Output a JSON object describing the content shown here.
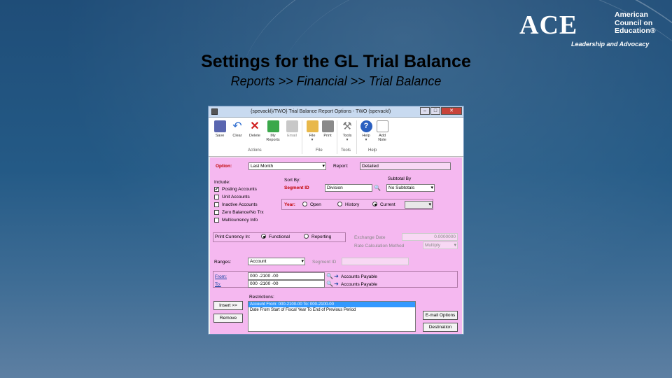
{
  "logo": {
    "wordmark": "ACE",
    "org_line1": "American",
    "org_line2": "Council on",
    "org_line3": "Education®",
    "tagline": "Leadership and Advocacy"
  },
  "slide": {
    "title": "Settings for the GL Trial Balance",
    "subtitle": "Reports >> Financial >> Trial Balance"
  },
  "window": {
    "title": "{spevackl}/TWO} Trial Balance Report Options  -  TWO (spevackl)"
  },
  "toolbar": {
    "save": "Save",
    "clear": "Clear",
    "delete": "Delete",
    "my_reports_1": "My",
    "my_reports_2": "Reports",
    "email": "Email",
    "file": "File",
    "print": "Print",
    "tools": "Tools",
    "help": "Help",
    "add_note_1": "Add",
    "add_note_2": "Note",
    "group_actions": "Actions",
    "group_file": "File",
    "group_tools": "Tools",
    "group_help": "Help"
  },
  "form": {
    "option_label": "Option:",
    "option_value": "Last Month",
    "report_label": "Report:",
    "report_value": "Detailed",
    "include_label": "Include:",
    "include_items": [
      {
        "label": "Posting Accounts",
        "checked": true
      },
      {
        "label": "Unit Accounts",
        "checked": false
      },
      {
        "label": "Inactive Accounts",
        "checked": false
      },
      {
        "label": "Zero Balance/No Trx",
        "checked": false
      },
      {
        "label": "Multicurrency Info",
        "checked": false
      }
    ],
    "sort_by_label": "Sort By:",
    "segment_id_label": "Segment ID",
    "segment_id_value": "Division",
    "subtotal_by_label": "Subtotal By",
    "subtotal_by_value": "No Subtotals",
    "year_label": "Year:",
    "year_options": [
      "Open",
      "History",
      "Current"
    ],
    "print_currency_label": "Print Currency In:",
    "currency_options": [
      "Functional",
      "Reporting"
    ],
    "exchange_date_label": "Exchange Date",
    "exchange_rate_value": "0.0000000",
    "rate_calc_label": "Rate Calculation Method",
    "rate_calc_value": "Multiply",
    "ranges_label": "Ranges:",
    "ranges_value": "Account",
    "segment_id2_label": "Segment ID",
    "from_label": "From:",
    "from_value": "000 -2100 -00",
    "from_desc": "Accounts Payable",
    "to_label": "To:",
    "to_value": "000 -2100 -00",
    "to_desc": "Accounts Payable",
    "restrictions_label": "Restrictions:",
    "restrictions": [
      "Account From: 000-2100-00 To: 000-2100-00",
      "Date From Start of Fiscal Year To End of Previous Period"
    ],
    "insert_btn": "Insert >>",
    "remove_btn": "Remove",
    "email_options_btn": "E-mail Options",
    "destination_btn": "Destination"
  }
}
